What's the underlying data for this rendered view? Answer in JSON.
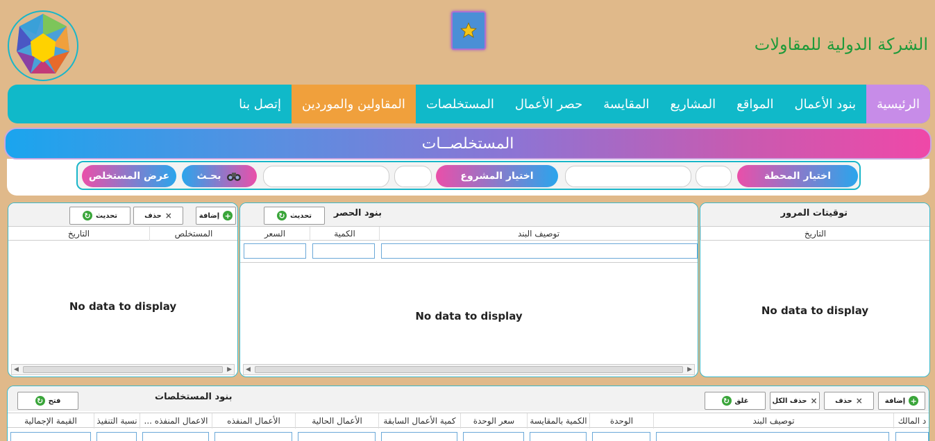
{
  "header": {
    "company_name": "الشركة الدولية للمقاولات",
    "logo_icon": "gem-logo-icon",
    "favorite_icon": "star-icon"
  },
  "nav": {
    "items": [
      {
        "label": "الرئيسية",
        "state": "home"
      },
      {
        "label": "بنود الأعمال"
      },
      {
        "label": "المواقع"
      },
      {
        "label": "المشاريع"
      },
      {
        "label": "المقايسة"
      },
      {
        "label": "حصر الأعمال"
      },
      {
        "label": "المستخلصات"
      },
      {
        "label": "المقاولين والموردين",
        "state": "active"
      },
      {
        "label": "إتصل بنا"
      }
    ]
  },
  "page": {
    "title": "المستخلصــات"
  },
  "filter": {
    "station_label": "اختيار المحطة",
    "project_label": "اختيار المشروع",
    "search_label": "بحـث",
    "show_label": "عرض المستخلص",
    "search_icon": "binoculars-icon"
  },
  "panels": {
    "traffic": {
      "title": "توقيتات المرور",
      "columns": [
        "التاريخ"
      ],
      "empty": "No data to display"
    },
    "survey": {
      "title": "بنود الحصر",
      "refresh": "تحديث",
      "columns": [
        "توصيف البند",
        "الكمية",
        "السعر"
      ],
      "empty": "No data to display"
    },
    "extracts": {
      "add": "إضافة",
      "delete": "حذف",
      "refresh": "تحديث",
      "columns": [
        "المستخلص",
        "التاريخ"
      ],
      "empty": "No data to display"
    }
  },
  "bottom": {
    "title": "بنود المستخلصات",
    "open": "فتح",
    "add": "إضافة",
    "delete": "حذف",
    "delete_all": "حذف الكل",
    "close": "غلق",
    "columns": [
      "د المالك",
      "توصيف البند",
      "الوحدة",
      "الكمية بالمقايسة",
      "سعر الوحدة",
      "كمية الأعمال السابقة",
      "الأعمال الحالية",
      "الأعمال المنفذه",
      "... الاعمال المنفذه",
      "نسبة التنفيذ",
      "القيمة الإجمالية"
    ]
  },
  "colors": {
    "nav": "#10b9c9",
    "active": "#f0a03c",
    "home": "#c78ce8",
    "title_green": "#1f9a3a"
  }
}
